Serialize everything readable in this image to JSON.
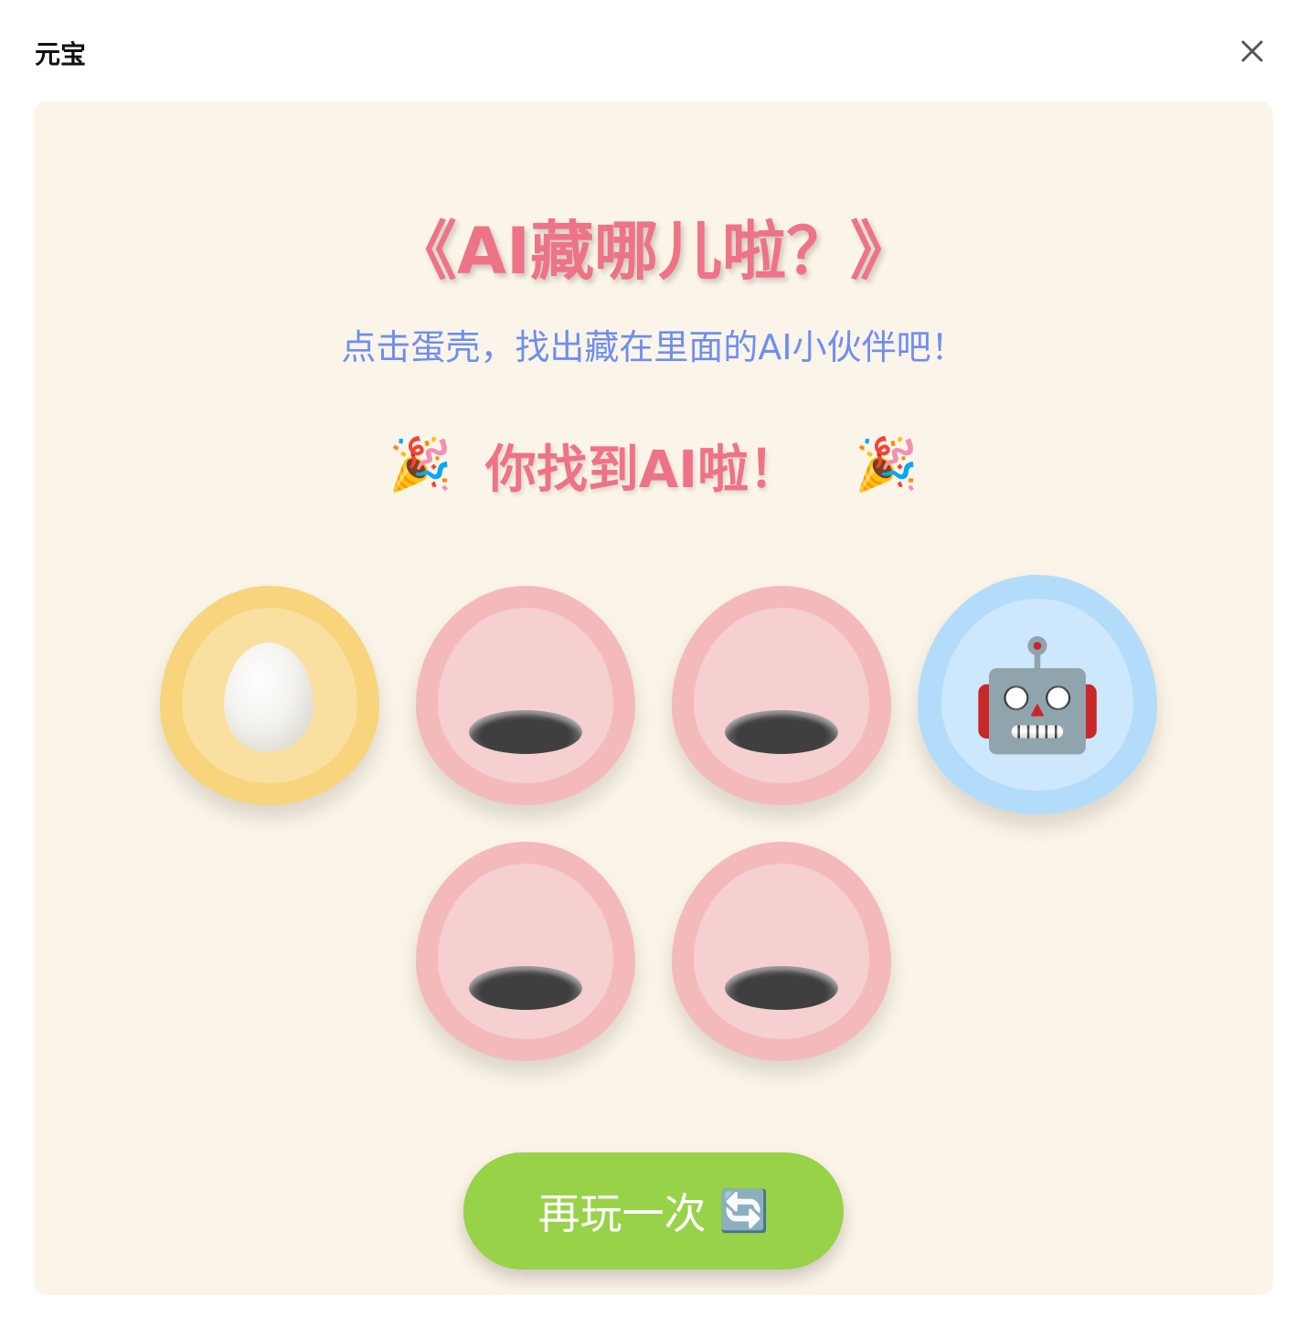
{
  "window": {
    "title": "元宝",
    "close_icon": "close-icon"
  },
  "game": {
    "title": "《AI藏哪儿啦？》",
    "subtitle": "点击蛋壳，找出藏在里面的AI小伙伴吧！",
    "result_message": "你找到AI啦！",
    "party_emoji": "🎉",
    "eggs": [
      {
        "state": "unopened",
        "color": "#f8d47c",
        "content": "egg"
      },
      {
        "state": "empty",
        "color": "#f4babb",
        "content": "hole"
      },
      {
        "state": "empty",
        "color": "#f4babb",
        "content": "hole"
      },
      {
        "state": "found",
        "color": "#b3dcfb",
        "content": "🤖"
      },
      {
        "state": "empty",
        "color": "#f4babb",
        "content": "hole"
      },
      {
        "state": "empty",
        "color": "#f4babb",
        "content": "hole"
      }
    ],
    "replay_button": {
      "label": "再玩一次",
      "icon": "🔄"
    }
  },
  "colors": {
    "title": "#ee7386",
    "subtitle": "#6f8ef0",
    "panel_background": "#fbf4e8",
    "button": "#97d248"
  }
}
